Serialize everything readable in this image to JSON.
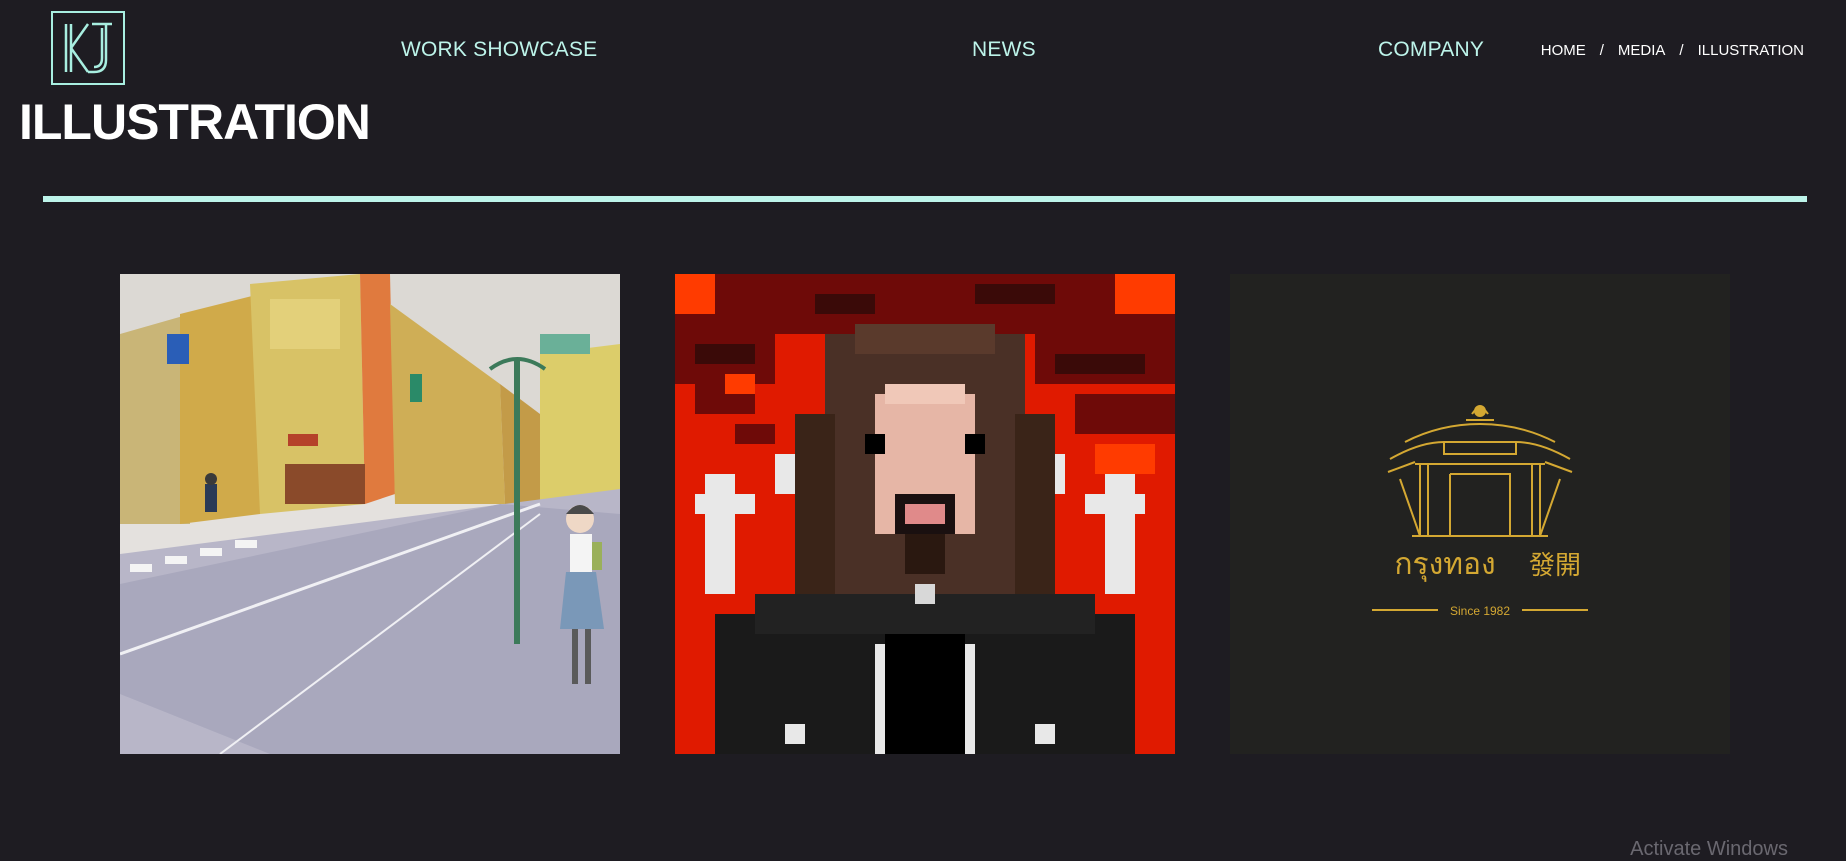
{
  "header": {
    "logo_text": "KJ",
    "nav": [
      {
        "label": "WORK SHOWCASE"
      },
      {
        "label": "NEWS"
      },
      {
        "label": "COMPANY"
      }
    ],
    "breadcrumb": [
      {
        "label": "HOME"
      },
      {
        "label": "MEDIA"
      },
      {
        "label": "ILLUSTRATION"
      }
    ],
    "breadcrumb_separator": "/"
  },
  "page": {
    "title": "ILLUSTRATION"
  },
  "gallery": [
    {
      "name": "watercolor-street-illustration"
    },
    {
      "name": "pixel-art-portrait"
    },
    {
      "name": "gold-gate-logo",
      "logo_thai": "กรุงทอง",
      "logo_cjk": "發開",
      "logo_since": "Since  1982"
    }
  ],
  "footer": {
    "watermark": "Activate Windows"
  },
  "colors": {
    "background": "#1e1c22",
    "accent": "#bdf4ea",
    "gold": "#d4a832"
  }
}
